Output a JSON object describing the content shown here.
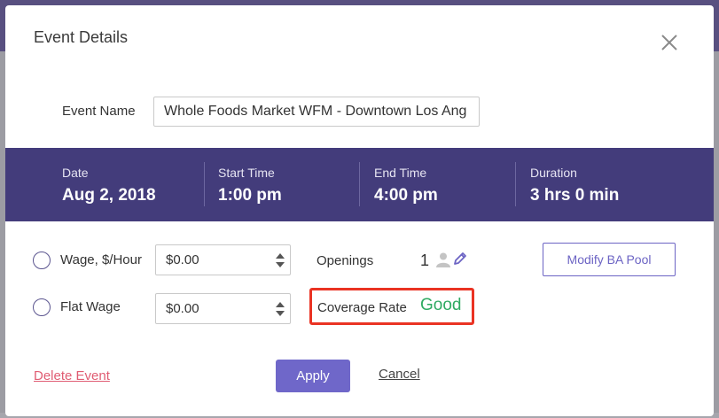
{
  "modal": {
    "title": "Event Details",
    "close_icon": "close-icon"
  },
  "event_name": {
    "label": "Event Name",
    "value": "Whole Foods Market WFM - Downtown Los Ang"
  },
  "schedule": {
    "date": {
      "label": "Date",
      "value": "Aug 2, 2018"
    },
    "start_time": {
      "label": "Start Time",
      "value": "1:00 pm"
    },
    "end_time": {
      "label": "End Time",
      "value": "4:00 pm"
    },
    "duration": {
      "label": "Duration",
      "value": "3 hrs 0 min"
    }
  },
  "wage": {
    "hourly": {
      "label": "Wage, $/Hour",
      "value": "$0.00",
      "selected": false
    },
    "flat": {
      "label": "Flat Wage",
      "value": "$0.00",
      "selected": false
    }
  },
  "openings": {
    "label": "Openings",
    "count": "1",
    "icons": [
      "person-icon",
      "pencil-icon"
    ]
  },
  "modify_pool": {
    "label": "Modify BA Pool"
  },
  "coverage": {
    "label": "Coverage Rate",
    "value": "Good",
    "value_color": "#2faa62",
    "highlight_color": "#ea3323"
  },
  "actions": {
    "delete_label": "Delete Event",
    "apply_label": "Apply",
    "cancel_label": "Cancel"
  },
  "colors": {
    "band": "#433c7b",
    "accent": "#6f67c9",
    "delete": "#e05d73"
  }
}
